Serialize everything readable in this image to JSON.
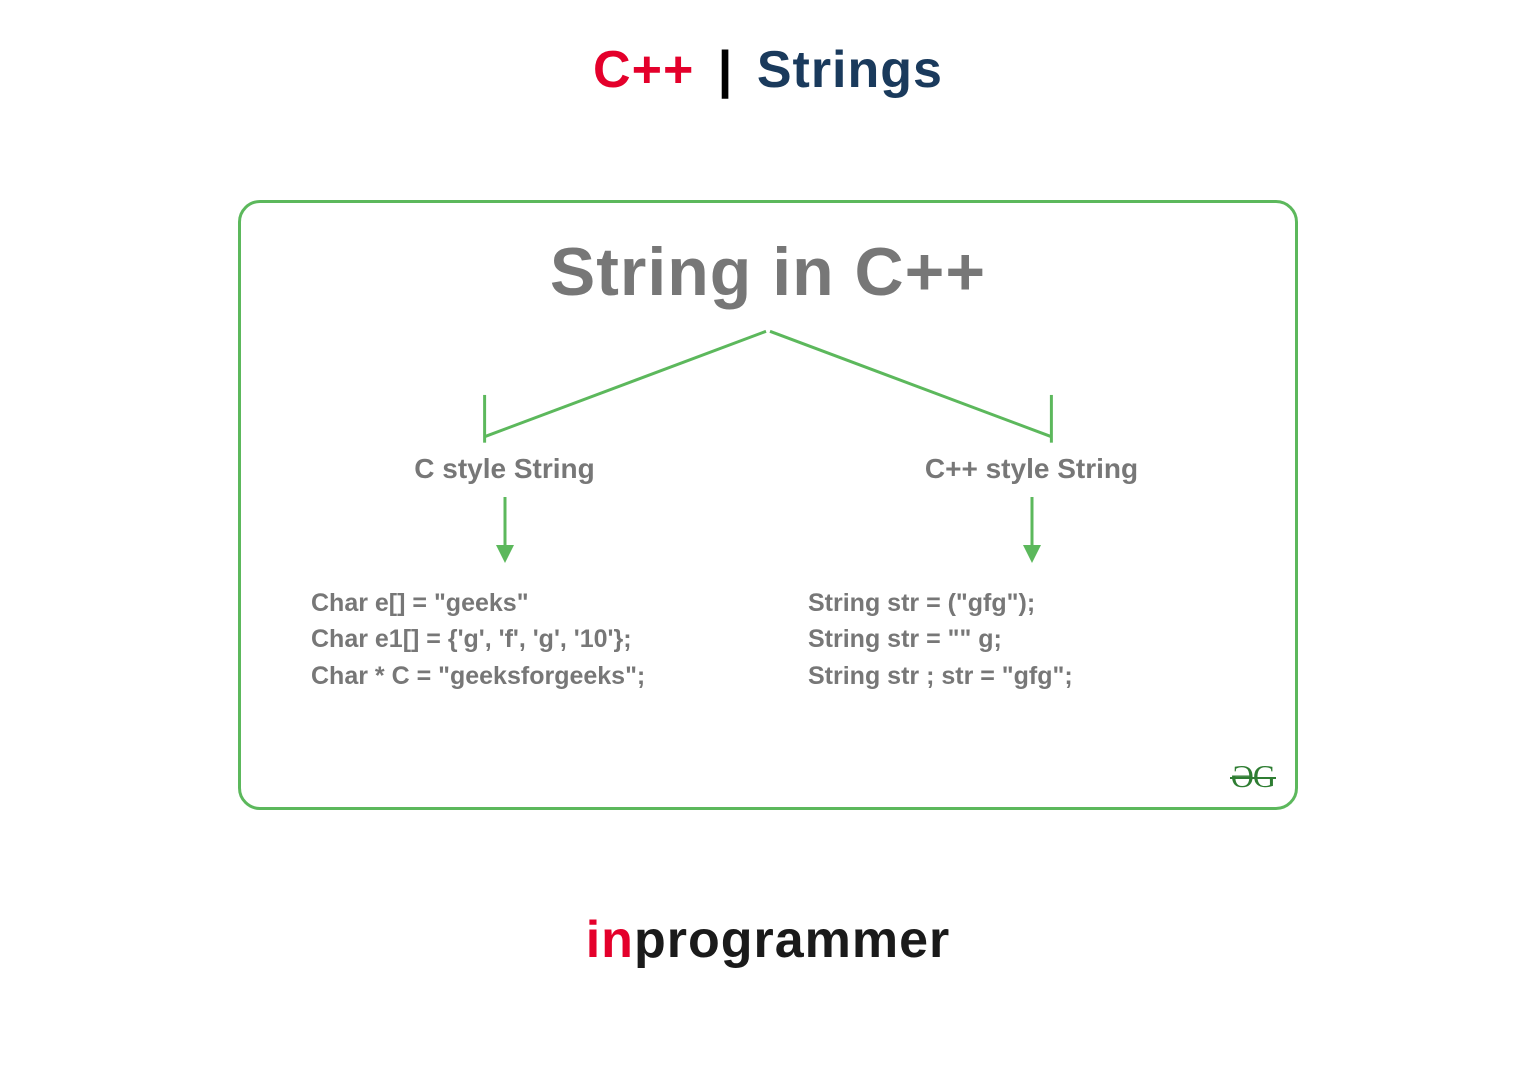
{
  "header": {
    "cpp": "C++",
    "separator": "|",
    "topic": "Strings"
  },
  "diagram": {
    "title": "String in C++",
    "left": {
      "label": "C style String",
      "code": [
        "Char e[] = \"geeks\"",
        "Char e1[] = {'g', 'f', 'g', '10'};",
        "Char * C = \"geeksforgeeks\";"
      ]
    },
    "right": {
      "label": "C++ style String",
      "code": [
        "String str = (\"gfg\");",
        "String str = \"\" g;",
        "String str ; str = \"gfg\";"
      ]
    },
    "attribution": "ƏG"
  },
  "footer": {
    "prefix": "in",
    "rest": "programmer"
  },
  "colors": {
    "accent_red": "#e4002b",
    "accent_blue": "#1a3a5c",
    "box_green": "#5cb85c",
    "text_gray": "#777777",
    "logo_green": "#2e7d32"
  }
}
